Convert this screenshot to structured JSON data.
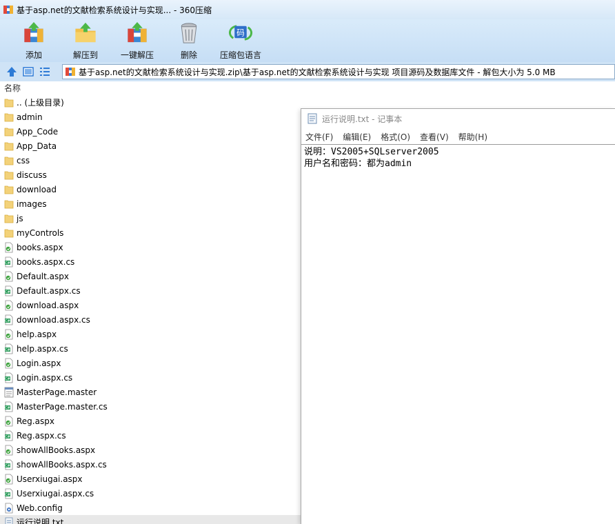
{
  "window": {
    "title": "基于asp.net的文献检索系统设计与实现... - 360压缩"
  },
  "toolbar": {
    "add": "添加",
    "extract_to": "解压到",
    "one_click_extract": "一键解压",
    "delete": "删除",
    "archive_language": "压缩包语言"
  },
  "address": {
    "path": "基于asp.net的文献检索系统设计与实现.zip\\基于asp.net的文献检索系统设计与实现 项目源码及数据库文件 - 解包大小为 5.0 MB"
  },
  "columns": {
    "name": "名称"
  },
  "files": [
    {
      "name": ".. (上级目录)",
      "type": "folder"
    },
    {
      "name": "admin",
      "type": "folder"
    },
    {
      "name": "App_Code",
      "type": "folder"
    },
    {
      "name": "App_Data",
      "type": "folder"
    },
    {
      "name": "css",
      "type": "folder"
    },
    {
      "name": "discuss",
      "type": "folder"
    },
    {
      "name": "download",
      "type": "folder"
    },
    {
      "name": "images",
      "type": "folder"
    },
    {
      "name": "js",
      "type": "folder"
    },
    {
      "name": "myControls",
      "type": "folder"
    },
    {
      "name": "books.aspx",
      "type": "aspx"
    },
    {
      "name": "books.aspx.cs",
      "type": "cs"
    },
    {
      "name": "Default.aspx",
      "type": "aspx"
    },
    {
      "name": "Default.aspx.cs",
      "type": "cs"
    },
    {
      "name": "download.aspx",
      "type": "aspx"
    },
    {
      "name": "download.aspx.cs",
      "type": "cs"
    },
    {
      "name": "help.aspx",
      "type": "aspx"
    },
    {
      "name": "help.aspx.cs",
      "type": "cs"
    },
    {
      "name": "Login.aspx",
      "type": "aspx"
    },
    {
      "name": "Login.aspx.cs",
      "type": "cs"
    },
    {
      "name": "MasterPage.master",
      "type": "master"
    },
    {
      "name": "MasterPage.master.cs",
      "type": "cs"
    },
    {
      "name": "Reg.aspx",
      "type": "aspx"
    },
    {
      "name": "Reg.aspx.cs",
      "type": "cs"
    },
    {
      "name": "showAllBooks.aspx",
      "type": "aspx"
    },
    {
      "name": "showAllBooks.aspx.cs",
      "type": "cs"
    },
    {
      "name": "Userxiugai.aspx",
      "type": "aspx"
    },
    {
      "name": "Userxiugai.aspx.cs",
      "type": "cs"
    },
    {
      "name": "Web.config",
      "type": "config"
    },
    {
      "name": "运行说明.txt",
      "type": "txt",
      "selected": true
    }
  ],
  "notepad": {
    "title": "运行说明.txt - 记事本",
    "menu": [
      "文件(F)",
      "编辑(E)",
      "格式(O)",
      "查看(V)",
      "帮助(H)"
    ],
    "content": "说明：VS2005+SQLserver2005\n用户名和密码：都为admin"
  }
}
